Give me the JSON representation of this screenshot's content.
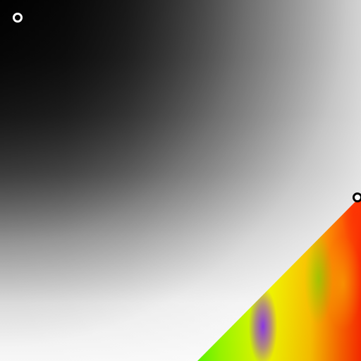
{
  "picker": {
    "shadow_color": "#050505",
    "light_color": "#f7f7f7",
    "spectrum_colors": [
      "#2300ff",
      "#0012ff",
      "#0084ff",
      "#00d57d",
      "#10ff00",
      "#9dff00",
      "#f5ff00",
      "#ffc300",
      "#ff6800",
      "#ff2a00"
    ],
    "marker_top_color": "#ffffff",
    "marker_right_fill": "#ffffff",
    "marker_right_border": "#000000"
  }
}
